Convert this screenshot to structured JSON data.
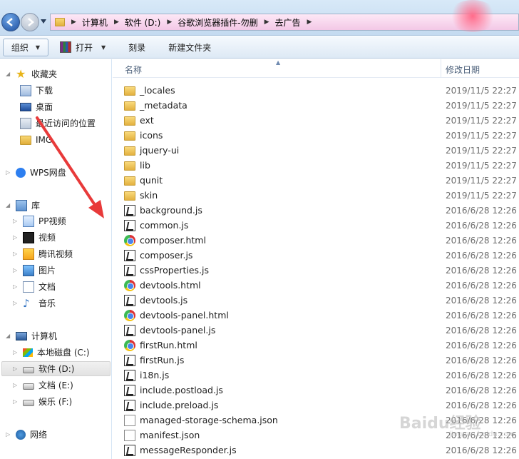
{
  "address": {
    "breadcrumbs": [
      "计算机",
      "软件 (D:)",
      "谷歌浏览器插件-勿删",
      "去广告"
    ]
  },
  "toolbar": {
    "organize": "组织",
    "open": "打开",
    "burn": "刻录",
    "new_folder": "新建文件夹"
  },
  "nav": {
    "favorites": "收藏夹",
    "downloads": "下载",
    "desktop": "桌面",
    "recent": "最近访问的位置",
    "img": "IMG",
    "wps": "WPS网盘",
    "libraries": "库",
    "pp": "PP视频",
    "videos": "视频",
    "tencent": "腾讯视频",
    "pictures": "图片",
    "documents": "文档",
    "music": "音乐",
    "computer": "计算机",
    "drive_c": "本地磁盘 (C:)",
    "drive_d": "软件 (D:)",
    "drive_e": "文档 (E:)",
    "drive_f": "娱乐 (F:)",
    "network": "网络"
  },
  "columns": {
    "name": "名称",
    "date": "修改日期"
  },
  "files": [
    {
      "name": "_locales",
      "date": "2019/11/5 22:27",
      "icon": "folder-icon"
    },
    {
      "name": "_metadata",
      "date": "2019/11/5 22:27",
      "icon": "folder-icon"
    },
    {
      "name": "ext",
      "date": "2019/11/5 22:27",
      "icon": "folder-icon"
    },
    {
      "name": "icons",
      "date": "2019/11/5 22:27",
      "icon": "folder-icon"
    },
    {
      "name": "jquery-ui",
      "date": "2019/11/5 22:27",
      "icon": "folder-icon"
    },
    {
      "name": "lib",
      "date": "2019/11/5 22:27",
      "icon": "folder-icon"
    },
    {
      "name": "qunit",
      "date": "2019/11/5 22:27",
      "icon": "folder-icon"
    },
    {
      "name": "skin",
      "date": "2019/11/5 22:27",
      "icon": "folder-icon"
    },
    {
      "name": "background.js",
      "date": "2016/6/28 12:26",
      "icon": "js-file-icon"
    },
    {
      "name": "common.js",
      "date": "2016/6/28 12:26",
      "icon": "js-file-icon"
    },
    {
      "name": "composer.html",
      "date": "2016/6/28 12:26",
      "icon": "chrome-html-icon"
    },
    {
      "name": "composer.js",
      "date": "2016/6/28 12:26",
      "icon": "js-file-icon"
    },
    {
      "name": "cssProperties.js",
      "date": "2016/6/28 12:26",
      "icon": "js-file-icon"
    },
    {
      "name": "devtools.html",
      "date": "2016/6/28 12:26",
      "icon": "chrome-html-icon"
    },
    {
      "name": "devtools.js",
      "date": "2016/6/28 12:26",
      "icon": "js-file-icon"
    },
    {
      "name": "devtools-panel.html",
      "date": "2016/6/28 12:26",
      "icon": "chrome-html-icon"
    },
    {
      "name": "devtools-panel.js",
      "date": "2016/6/28 12:26",
      "icon": "js-file-icon"
    },
    {
      "name": "firstRun.html",
      "date": "2016/6/28 12:26",
      "icon": "chrome-html-icon"
    },
    {
      "name": "firstRun.js",
      "date": "2016/6/28 12:26",
      "icon": "js-file-icon"
    },
    {
      "name": "i18n.js",
      "date": "2016/6/28 12:26",
      "icon": "js-file-icon"
    },
    {
      "name": "include.postload.js",
      "date": "2016/6/28 12:26",
      "icon": "js-file-icon"
    },
    {
      "name": "include.preload.js",
      "date": "2016/6/28 12:26",
      "icon": "js-file-icon"
    },
    {
      "name": "managed-storage-schema.json",
      "date": "2016/6/28 12:26",
      "icon": "json-file-icon"
    },
    {
      "name": "manifest.json",
      "date": "2016/6/28 12:26",
      "icon": "json-file-icon"
    },
    {
      "name": "messageResponder.js",
      "date": "2016/6/28 12:26",
      "icon": "js-file-icon"
    }
  ],
  "watermark": {
    "brand": "Baidu经验",
    "url": "jingyan.baidu.com"
  }
}
